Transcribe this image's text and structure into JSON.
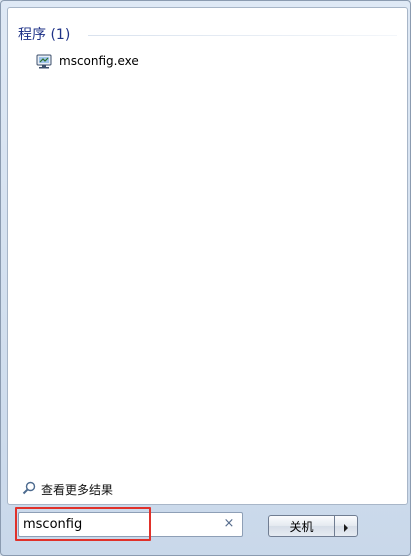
{
  "results": {
    "section_title": "程序 (1)",
    "items": [
      {
        "label": "msconfig.exe",
        "icon": "system-config-icon"
      }
    ]
  },
  "more_results": {
    "label": "查看更多结果",
    "icon": "search-icon"
  },
  "search": {
    "value": "msconfig",
    "clear_glyph": "×"
  },
  "shutdown": {
    "label": "关机",
    "arrow_icon": "triangle-right-icon"
  },
  "colors": {
    "highlight": "#e0312a",
    "section_title": "#1e3287"
  }
}
